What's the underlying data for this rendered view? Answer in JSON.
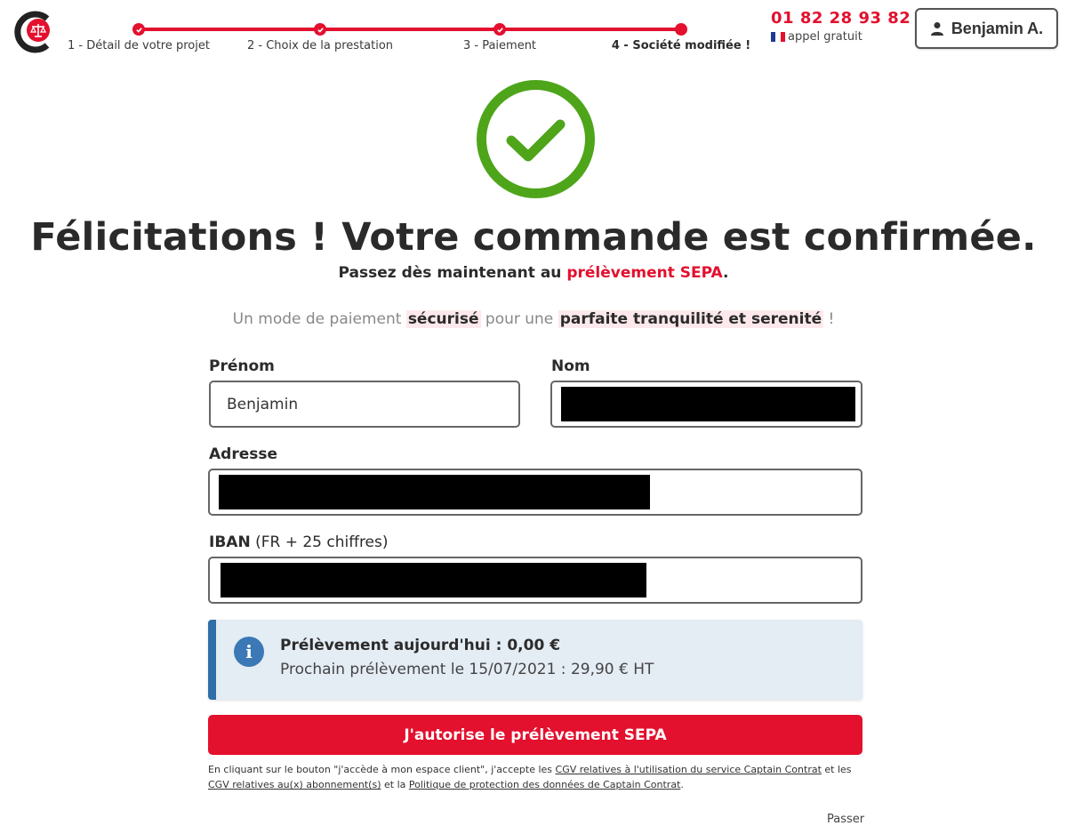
{
  "header": {
    "steps": [
      {
        "label": "1 - Détail de votre projet",
        "state": "done"
      },
      {
        "label": "2 - Choix de la prestation",
        "state": "done"
      },
      {
        "label": "3 - Paiement",
        "state": "done"
      },
      {
        "label": "4 - Société modifiée !",
        "state": "current"
      }
    ],
    "phone_number": "01 82 28 93 82",
    "phone_note": "appel gratuit",
    "user_name": "Benjamin A."
  },
  "hero": {
    "title": "Félicitations ! Votre commande est confirmée.",
    "subtitle_prefix": "Passez dès maintenant au ",
    "subtitle_accent": "prélèvement SEPA",
    "subtitle_suffix": ".",
    "tagline_1": "Un mode de paiement ",
    "tagline_hl_1": "sécurisé",
    "tagline_2": " pour une ",
    "tagline_hl_2": "parfaite tranquilité et serenité",
    "tagline_3": " !"
  },
  "form": {
    "prenom_label": "Prénom",
    "prenom_value": "Benjamin",
    "nom_label": "Nom",
    "adresse_label": "Adresse",
    "iban_label": "IBAN",
    "iban_hint": " (FR + 25 chiffres)"
  },
  "info": {
    "line1": "Prélèvement aujourd'hui : 0,00 €",
    "line2": "Prochain prélèvement le 15/07/2021 : 29,90 € HT",
    "icon": "i"
  },
  "cta_label": "J'autorise le prélèvement SEPA",
  "legal": {
    "text_1": "En cliquant sur le bouton \"j'accède à mon espace client\", j'accepte les ",
    "link_1": "CGV relatives à l'utilisation du service Captain Contrat",
    "text_2": " et les ",
    "link_2": "CGV relatives au(x) abonnement(s)",
    "text_3": " et la ",
    "link_3": "Politique de protection des données de Captain Contrat",
    "text_4": "."
  },
  "skip_label": "Passer",
  "colors": {
    "brand_red": "#e3102e",
    "success_green": "#4ea51a",
    "info_blue": "#2f6ea8"
  }
}
